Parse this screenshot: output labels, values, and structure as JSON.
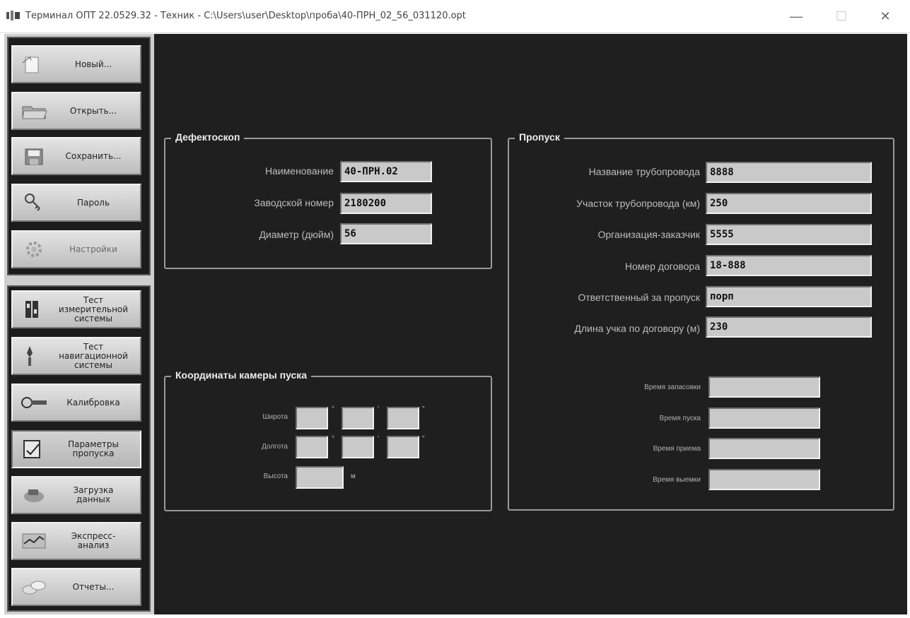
{
  "window": {
    "title": "Терминал ОПТ 22.0529.32 - Техник - C:\\Users\\user\\Desktop\\проба\\40-ПРН_02_56_031120.opt",
    "min_glyph": "—",
    "max_glyph": "☐",
    "close_glyph": "✕"
  },
  "sidebar": {
    "group1": [
      {
        "label": "Новый...",
        "icon": "new-file-icon"
      },
      {
        "label": "Открыть...",
        "icon": "open-folder-icon"
      },
      {
        "label": "Сохранить...",
        "icon": "save-disk-icon"
      },
      {
        "label": "Пароль",
        "icon": "keys-icon"
      },
      {
        "label": "Настройки",
        "icon": "settings-icon",
        "disabled": true
      }
    ],
    "group2": [
      {
        "label": "Тест\nизмерительной\nсистемы",
        "icon": "measure-test-icon"
      },
      {
        "label": "Тест\nнавигационной\nсистемы",
        "icon": "navigation-test-icon"
      },
      {
        "label": "Калибровка",
        "icon": "calibration-icon"
      },
      {
        "label": "Параметры\nпропуска",
        "icon": "parameters-icon",
        "active": true
      },
      {
        "label": "Загрузка\nданных",
        "icon": "data-load-icon"
      },
      {
        "label": "Экспресс-\nанализ",
        "icon": "express-analysis-icon"
      },
      {
        "label": "Отчеты...",
        "icon": "reports-icon"
      }
    ]
  },
  "defectoscope": {
    "title": "Дефектоскоп",
    "name_label": "Наименование",
    "name_value": "40-ПРН.02",
    "serial_label": "Заводской номер",
    "serial_value": "2180200",
    "diameter_label": "Диаметр (дюйм)",
    "diameter_value": "56"
  },
  "coordinates": {
    "title": "Координаты камеры пуска",
    "lat_label": "Широта",
    "lon_label": "Долгота",
    "alt_label": "Высота",
    "deg_mark": "°",
    "min_mark": "'",
    "sec_mark": "\"",
    "alt_unit": "м",
    "lat_deg": "",
    "lat_min": "",
    "lat_sec": "",
    "lon_deg": "",
    "lon_min": "",
    "lon_sec": "",
    "alt_value": ""
  },
  "pass": {
    "title": "Пропуск",
    "pipeline_name_label": "Название трубопровода",
    "pipeline_name_value": "8888",
    "section_label": "Участок трубопровода (км)",
    "section_value": "250",
    "customer_label": "Организация-заказчик",
    "customer_value": "5555",
    "contract_label": "Номер договора",
    "contract_value": "18-888",
    "responsible_label": "Ответственный за пропуск",
    "responsible_value": "порп",
    "length_label": "Длина учка по договору (м)",
    "length_value": "230",
    "load_time_label": "Время запасовки",
    "load_time_value": "",
    "launch_time_label": "Время пуска",
    "launch_time_value": "",
    "receive_time_label": "Время приема",
    "receive_time_value": "",
    "extract_time_label": "Время выемки",
    "extract_time_value": ""
  }
}
